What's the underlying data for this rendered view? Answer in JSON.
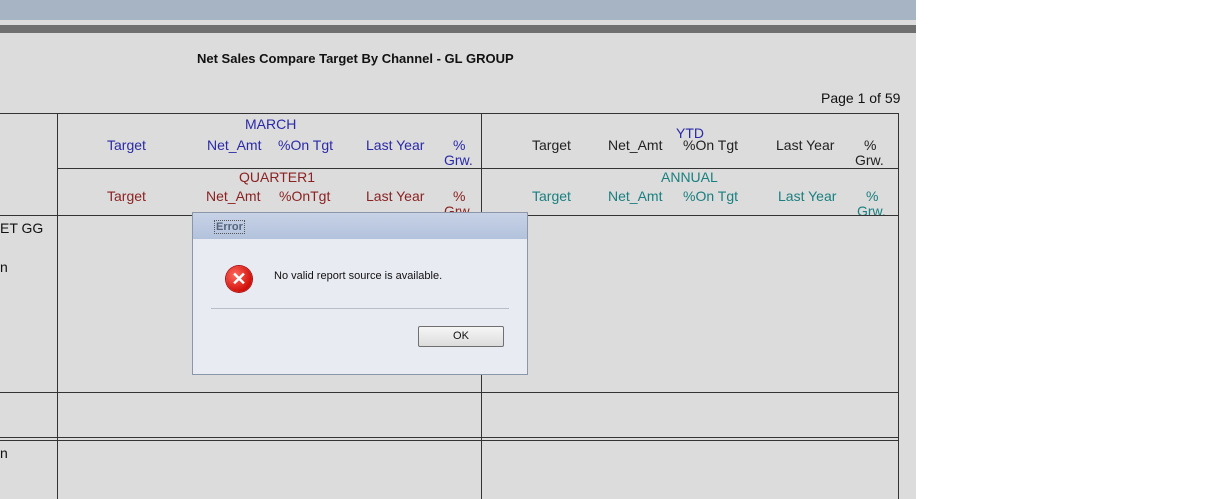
{
  "report": {
    "title": "Net Sales Compare Target By Channel - GL GROUP",
    "page_info": "Page 1 of 59",
    "monthly_header": {
      "period": "MARCH",
      "cols": [
        "Target",
        "Net_Amt",
        "%On Tgt",
        "Last Year",
        "%",
        "Grw."
      ]
    },
    "ytd_header": {
      "period": "YTD",
      "cols": [
        "Target",
        "Net_Amt",
        "%On Tgt",
        "Last Year",
        "%",
        "Grw."
      ]
    },
    "quarter_header": {
      "period": "QUARTER1",
      "cols": [
        "Target",
        "Net_Amt",
        "%OnTgt",
        "Last Year",
        "%",
        "Grw."
      ]
    },
    "annual_header": {
      "period": "ANNUAL",
      "cols": [
        "Target",
        "Net_Amt",
        "%On Tgt",
        "Last Year",
        "%",
        "Grw."
      ]
    },
    "row_labels": [
      "ET GG",
      "n",
      "n"
    ]
  },
  "dialog": {
    "title": "Error",
    "message": "No valid report source is available.",
    "ok_label": "OK",
    "icon": "error-x-icon"
  },
  "colors": {
    "monthly_blue": "#2a2aa8",
    "quarter_red": "#8b2222",
    "annual_teal": "#1a7f7f",
    "error_red": "#d1100a"
  }
}
